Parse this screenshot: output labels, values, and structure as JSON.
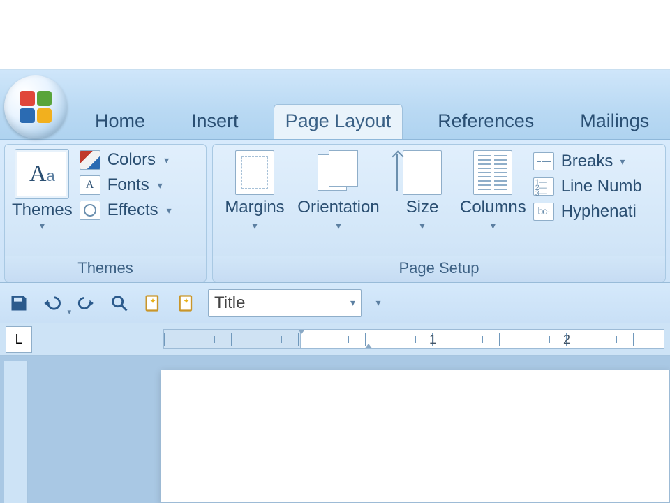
{
  "tabs": {
    "home": "Home",
    "insert": "Insert",
    "page_layout": "Page Layout",
    "references": "References",
    "mailings": "Mailings",
    "active": "page_layout"
  },
  "ribbon": {
    "themes": {
      "group_label": "Themes",
      "themes_button": "Themes",
      "colors": "Colors",
      "fonts": "Fonts",
      "effects": "Effects"
    },
    "page_setup": {
      "group_label": "Page Setup",
      "margins": "Margins",
      "orientation": "Orientation",
      "size": "Size",
      "columns": "Columns",
      "breaks": "Breaks",
      "line_numbers": "Line Numb",
      "hyphenation": "Hyphenati"
    }
  },
  "qat": {
    "style_selected": "Title"
  },
  "ruler": {
    "tabstop_glyph": "L",
    "numbers": [
      "1",
      "2"
    ]
  },
  "caret": "▾"
}
